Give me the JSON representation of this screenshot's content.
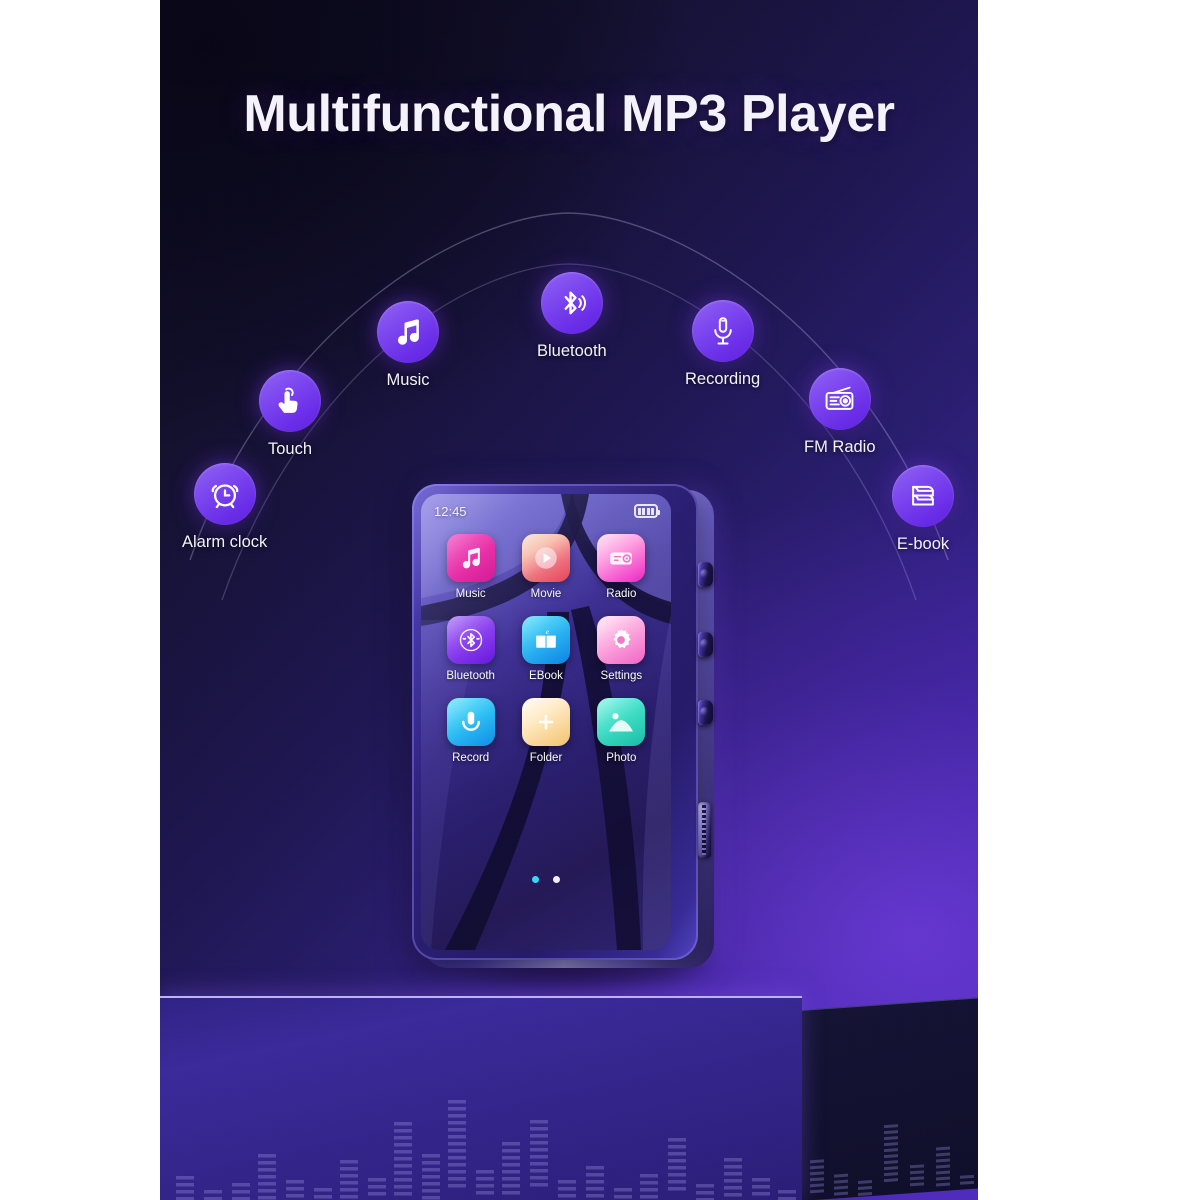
{
  "image": {
    "headline": "Multifunctional MP3 Player",
    "background_colors": {
      "dark": "#0a0818",
      "mid": "#2d1f78",
      "accent": "#4b2dbd"
    }
  },
  "features": [
    {
      "label": "Alarm clock",
      "icon": "alarm-clock-icon"
    },
    {
      "label": "Touch",
      "icon": "touch-hand-icon"
    },
    {
      "label": "Music",
      "icon": "music-note-icon"
    },
    {
      "label": "Bluetooth",
      "icon": "bluetooth-icon"
    },
    {
      "label": "Recording",
      "icon": "microphone-icon"
    },
    {
      "label": "FM Radio",
      "icon": "radio-icon"
    },
    {
      "label": "E-book",
      "icon": "ebook-stack-icon"
    }
  ],
  "device": {
    "status_bar": {
      "time": "12:45",
      "battery_icon": "battery-full-icon",
      "battery_bars": 4
    },
    "apps": [
      {
        "label": "Music",
        "icon": "music-note-icon",
        "color_start": "#ff3fb0",
        "color_end": "#e6219a"
      },
      {
        "label": "Movie",
        "icon": "play-circle-icon",
        "color_start": "#ffe2c4",
        "color_end": "#f0495f"
      },
      {
        "label": "Radio",
        "icon": "radio-icon",
        "color_start": "#ffd4ee",
        "color_end": "#e41fc0"
      },
      {
        "label": "Bluetooth",
        "icon": "bluetooth-icon",
        "color_start": "#a264f2",
        "color_end": "#6a14e0"
      },
      {
        "label": "EBook",
        "icon": "open-book-icon",
        "color_start": "#3fd8f5",
        "color_end": "#1190ea"
      },
      {
        "label": "Settings",
        "icon": "gear-icon",
        "color_start": "#ffe0f2",
        "color_end": "#f25fc2"
      },
      {
        "label": "Record",
        "icon": "microphone-icon",
        "color_start": "#4fe0f7",
        "color_end": "#1b96ec"
      },
      {
        "label": "Folder",
        "icon": "folder-plus-icon",
        "color_start": "#fff3dd",
        "color_end": "#f0c370"
      },
      {
        "label": "Photo",
        "icon": "photo-icon",
        "color_start": "#73f2df",
        "color_end": "#1fc9b0"
      }
    ],
    "page_dots": [
      {
        "state": "active",
        "color": "#34d8f7"
      },
      {
        "state": "inactive",
        "color": "#f2eefc"
      }
    ],
    "side_buttons": [
      "volume-up-button",
      "volume-down-button",
      "power-button"
    ],
    "speaker": "speaker-grille"
  }
}
